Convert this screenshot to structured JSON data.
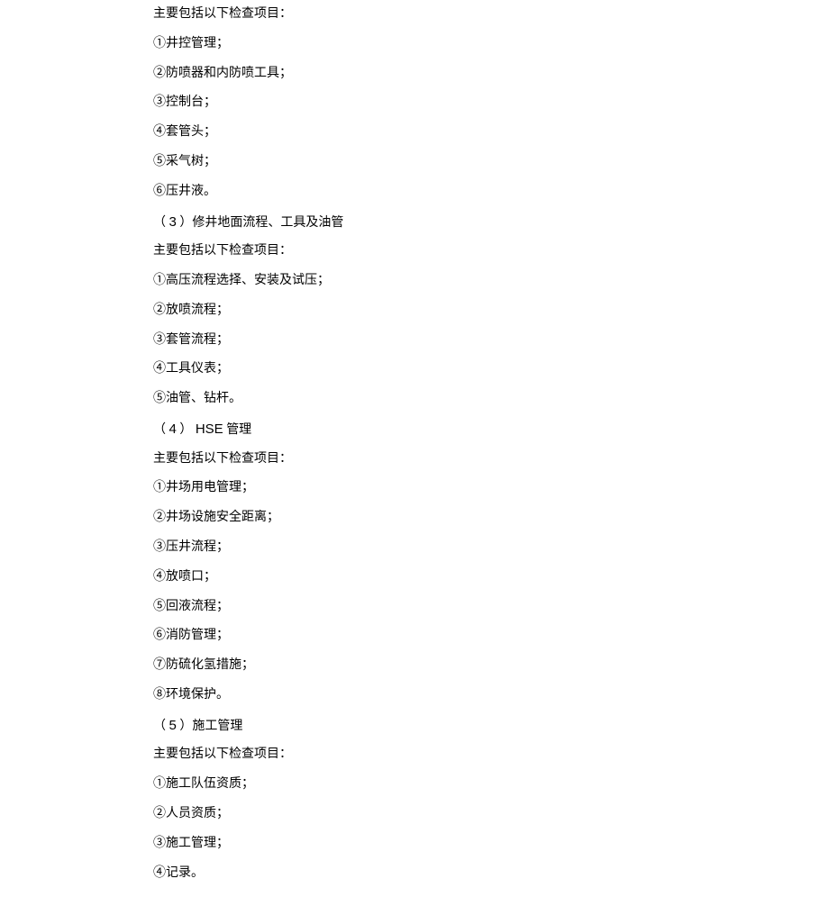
{
  "sections": [
    {
      "intro": "主要包括以下检查项目：",
      "items": [
        "①井控管理；",
        "②防喷器和内防喷工具；",
        "③控制台；",
        "④套管头；",
        "⑤采气树；",
        "⑥压井液。"
      ]
    },
    {
      "num": "3",
      "title": "修井地面流程、工具及油管",
      "intro": "主要包括以下检查项目：",
      "items": [
        "①高压流程选择、安装及试压；",
        "②放喷流程；",
        "③套管流程；",
        "④工具仪表；",
        "⑤油管、钻杆。"
      ]
    },
    {
      "num": "4",
      "title_latin": "HSE",
      "title": "管理",
      "intro": "主要包括以下检查项目：",
      "items": [
        "①井场用电管理；",
        "②井场设施安全距离；",
        "③压井流程；",
        "④放喷口；",
        "⑤回液流程；",
        "⑥消防管理；",
        "⑦防硫化氢措施；",
        "⑧环境保护。"
      ]
    },
    {
      "num": "5",
      "title": "施工管理",
      "intro": "主要包括以下检查项目：",
      "items": [
        "①施工队伍资质；",
        "②人员资质；",
        "③施工管理；",
        "④记录。"
      ]
    }
  ]
}
